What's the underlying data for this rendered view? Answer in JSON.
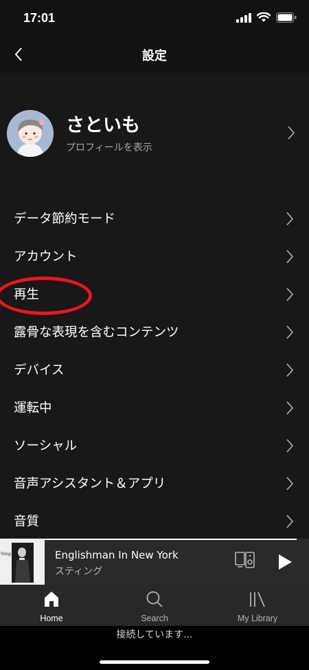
{
  "status": {
    "time": "17:01"
  },
  "header": {
    "title": "設定"
  },
  "profile": {
    "name": "さといも",
    "subtitle": "プロフィールを表示"
  },
  "menu": {
    "items": [
      {
        "label": "データ節約モード"
      },
      {
        "label": "アカウント"
      },
      {
        "label": "再生",
        "highlighted": true
      },
      {
        "label": "露骨な表現を含むコンテンツ"
      },
      {
        "label": "デバイス"
      },
      {
        "label": "運転中"
      },
      {
        "label": "ソーシャル"
      },
      {
        "label": "音声アシスタント＆アプリ"
      },
      {
        "label": "音質"
      }
    ]
  },
  "player": {
    "track": "Englishman In New York",
    "artist": "スティング",
    "album_art_text": "Sting"
  },
  "tabs": [
    {
      "label": "Home",
      "icon": "home-icon",
      "active": true
    },
    {
      "label": "Search",
      "icon": "search-icon",
      "active": false
    },
    {
      "label": "My Library",
      "icon": "library-icon",
      "active": false
    }
  ],
  "connect": {
    "text": "接続しています..."
  },
  "colors": {
    "background": "#181818",
    "highlight": "#e8171c",
    "player_bg": "#2a2a2a",
    "tab_bg": "#282828"
  }
}
